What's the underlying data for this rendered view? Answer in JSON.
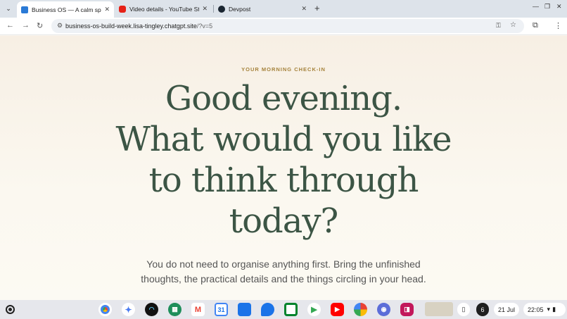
{
  "browser": {
    "tabs": [
      {
        "title": "Business OS — A calm space to",
        "active": true
      },
      {
        "title": "Video details - YouTube Studio",
        "active": false
      },
      {
        "title": "Devpost",
        "active": false
      }
    ],
    "tab_close_glyph": "✕",
    "new_tab_glyph": "+",
    "url_host": "business-os-build-week.lisa-tingley.chatgpt.site",
    "url_rest": "/?v=5"
  },
  "page": {
    "eyebrow": "YOUR MORNING CHECK-IN",
    "headline_lines": [
      "Good evening.",
      "What would you like",
      "to think through",
      "today?"
    ],
    "subline_lines": [
      "You do not need to organise anything first. Bring the unfinished",
      "thoughts, the practical details and the things circling in your head."
    ]
  },
  "shelf": {
    "apps": [
      "chrome-icon",
      "gemini-icon",
      "audio-app-icon",
      "apps-grid-icon",
      "gmail-icon",
      "calendar-icon",
      "files-icon",
      "messages-icon",
      "meet-icon",
      "play-store-icon",
      "youtube-icon",
      "photos-icon",
      "camera-app-icon",
      "screen-recorder-icon"
    ],
    "calendar_day": "31",
    "status_badge": "6",
    "date": "21 Jul",
    "time": "22:05"
  },
  "colors": {
    "headline": "#3c5545",
    "eyebrow": "#a5823b",
    "subline": "#555555",
    "page_bg": "#fbf7ef"
  }
}
